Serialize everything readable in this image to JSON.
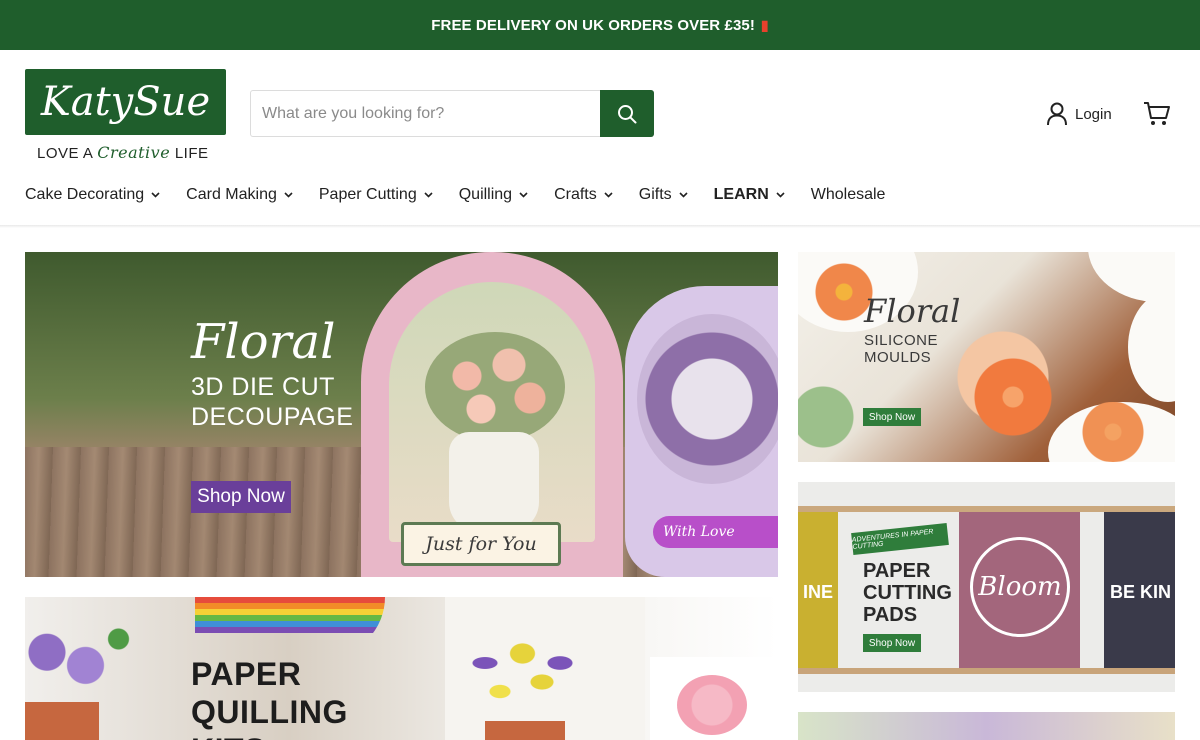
{
  "announcement": {
    "text": "FREE DELIVERY ON UK ORDERS OVER £35!",
    "icon": "delivery-truck-icon"
  },
  "logo": {
    "brand": "KatySue",
    "tagline_part1": "LOVE A",
    "tagline_script": "Creative",
    "tagline_part2": "LIFE"
  },
  "search": {
    "placeholder": "What are you looking for?",
    "value": "",
    "icon": "search-icon"
  },
  "account": {
    "login_label": "Login",
    "icon": "user-icon"
  },
  "cart": {
    "icon": "cart-icon"
  },
  "nav": {
    "items": [
      {
        "label": "Cake Decorating",
        "has_dropdown": true
      },
      {
        "label": "Card Making",
        "has_dropdown": true
      },
      {
        "label": "Paper Cutting",
        "has_dropdown": true
      },
      {
        "label": "Quilling",
        "has_dropdown": true
      },
      {
        "label": "Crafts",
        "has_dropdown": true
      },
      {
        "label": "Gifts",
        "has_dropdown": true
      },
      {
        "label": "LEARN",
        "has_dropdown": true,
        "bold": true
      },
      {
        "label": "Wholesale",
        "has_dropdown": false
      }
    ]
  },
  "banners": {
    "decoupage": {
      "title": "Floral",
      "subtitle": "3D DIE CUT DECOUPAGE",
      "button": "Shop Now",
      "card_label": "Just for You",
      "ribbon_text": "With Love"
    },
    "moulds": {
      "title": "Floral",
      "subtitle_line1": "SILICONE",
      "subtitle_line2": "MOULDS",
      "button": "Shop Now"
    },
    "pads": {
      "ribbon": "ADVENTURES IN PAPER CUTTING",
      "title_line1": "PAPER",
      "title_line2": "CUTTING",
      "title_line3": "PADS",
      "button": "Shop Now",
      "poster_word": "Bloom",
      "left_poster_text": "INE",
      "right_poster_text": "BE KIN"
    },
    "quilling": {
      "title_line1": "PAPER",
      "title_line2": "QUILLING",
      "title_line3": "KITS"
    }
  },
  "colors": {
    "brand_green": "#1f5e2c",
    "shop_now_purple": "#6a3f9a",
    "badge_green": "#2f7d3b"
  }
}
